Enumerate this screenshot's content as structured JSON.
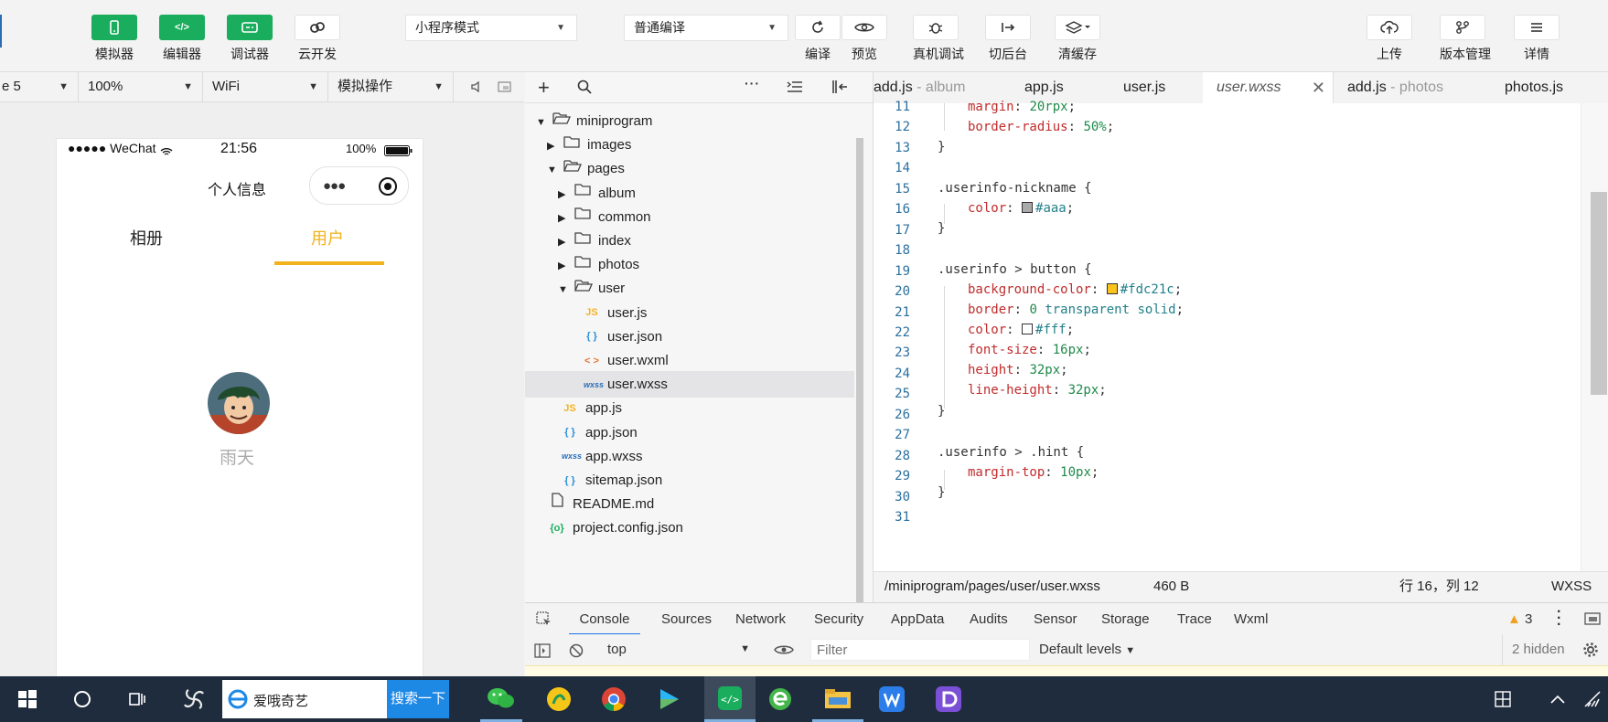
{
  "toolbar": {
    "simulator": "模拟器",
    "editor": "编辑器",
    "debugger": "调试器",
    "cloud": "云开发",
    "mode": "小程序模式",
    "compile_mode": "普通编译",
    "compile": "编译",
    "preview": "预览",
    "remote_debug": "真机调试",
    "background": "切后台",
    "clear_cache": "清缓存",
    "upload": "上传",
    "version": "版本管理",
    "details": "详情"
  },
  "simulator_bar": {
    "device": "e 5",
    "zoom": "100%",
    "network": "WiFi",
    "operation": "模拟操作"
  },
  "phone": {
    "carrier": "●●●●● WeChat",
    "time": "21:56",
    "battery": "100%",
    "nav_title": "个人信息",
    "tab_album": "相册",
    "tab_user": "用户",
    "nickname": "雨天"
  },
  "explorer": {
    "items": [
      {
        "label": "miniprogram"
      },
      {
        "label": "images"
      },
      {
        "label": "pages"
      },
      {
        "label": "album"
      },
      {
        "label": "common"
      },
      {
        "label": "index"
      },
      {
        "label": "photos"
      },
      {
        "label": "user"
      },
      {
        "label": "user.js"
      },
      {
        "label": "user.json"
      },
      {
        "label": "user.wxml"
      },
      {
        "label": "user.wxss"
      },
      {
        "label": "app.js"
      },
      {
        "label": "app.json"
      },
      {
        "label": "app.wxss"
      },
      {
        "label": "sitemap.json"
      },
      {
        "label": "README.md"
      },
      {
        "label": "project.config.json"
      }
    ]
  },
  "tabs": [
    {
      "name": "add.js",
      "hint": "- album"
    },
    {
      "name": "app.js",
      "hint": ""
    },
    {
      "name": "user.js",
      "hint": ""
    },
    {
      "name": "user.wxss",
      "hint": ""
    },
    {
      "name": "add.js",
      "hint": "- photos"
    },
    {
      "name": "photos.js",
      "hint": ""
    }
  ],
  "code": {
    "line_numbers": [
      "11",
      "12",
      "13",
      "14",
      "15",
      "16",
      "17",
      "18",
      "19",
      "20",
      "21",
      "22",
      "23",
      "24",
      "25",
      "26",
      "27",
      "28",
      "29",
      "30",
      "31"
    ],
    "l11p": "margin",
    "l11v": "20rpx",
    "l12p": "border-radius",
    "l12v": "50%",
    "brace_close": "}",
    "l15": ".userinfo-nickname {",
    "l16p": "color",
    "l16v": "#aaa",
    "l19": ".userinfo > button {",
    "l20p": "background-color",
    "l20v": "#fdc21c",
    "l21p": "border",
    "l21n": "0",
    "l21v": "transparent solid",
    "l22p": "color",
    "l22v": "#fff",
    "l23p": "font-size",
    "l23v": "16px",
    "l24p": "height",
    "l24v": "32px",
    "l25p": "line-height",
    "l25v": "32px",
    "l28": ".userinfo > .hint {",
    "l29p": "margin-top",
    "l29v": "10px"
  },
  "status": {
    "path": "/miniprogram/pages/user/user.wxss",
    "size": "460 B",
    "position": "行 16，列 12",
    "lang": "WXSS"
  },
  "devtools": {
    "tabs": [
      "Console",
      "Sources",
      "Network",
      "Security",
      "AppData",
      "Audits",
      "Sensor",
      "Storage",
      "Trace",
      "Wxml"
    ],
    "warnings": "3",
    "context": "top",
    "filter_placeholder": "Filter",
    "levels": "Default levels",
    "hidden": "2 hidden"
  },
  "taskbar": {
    "search_text": "爱哦奇艺",
    "search_button": "搜索一下"
  },
  "colors": {
    "green": "#1aad5d",
    "yellow": "#fdc21c"
  }
}
